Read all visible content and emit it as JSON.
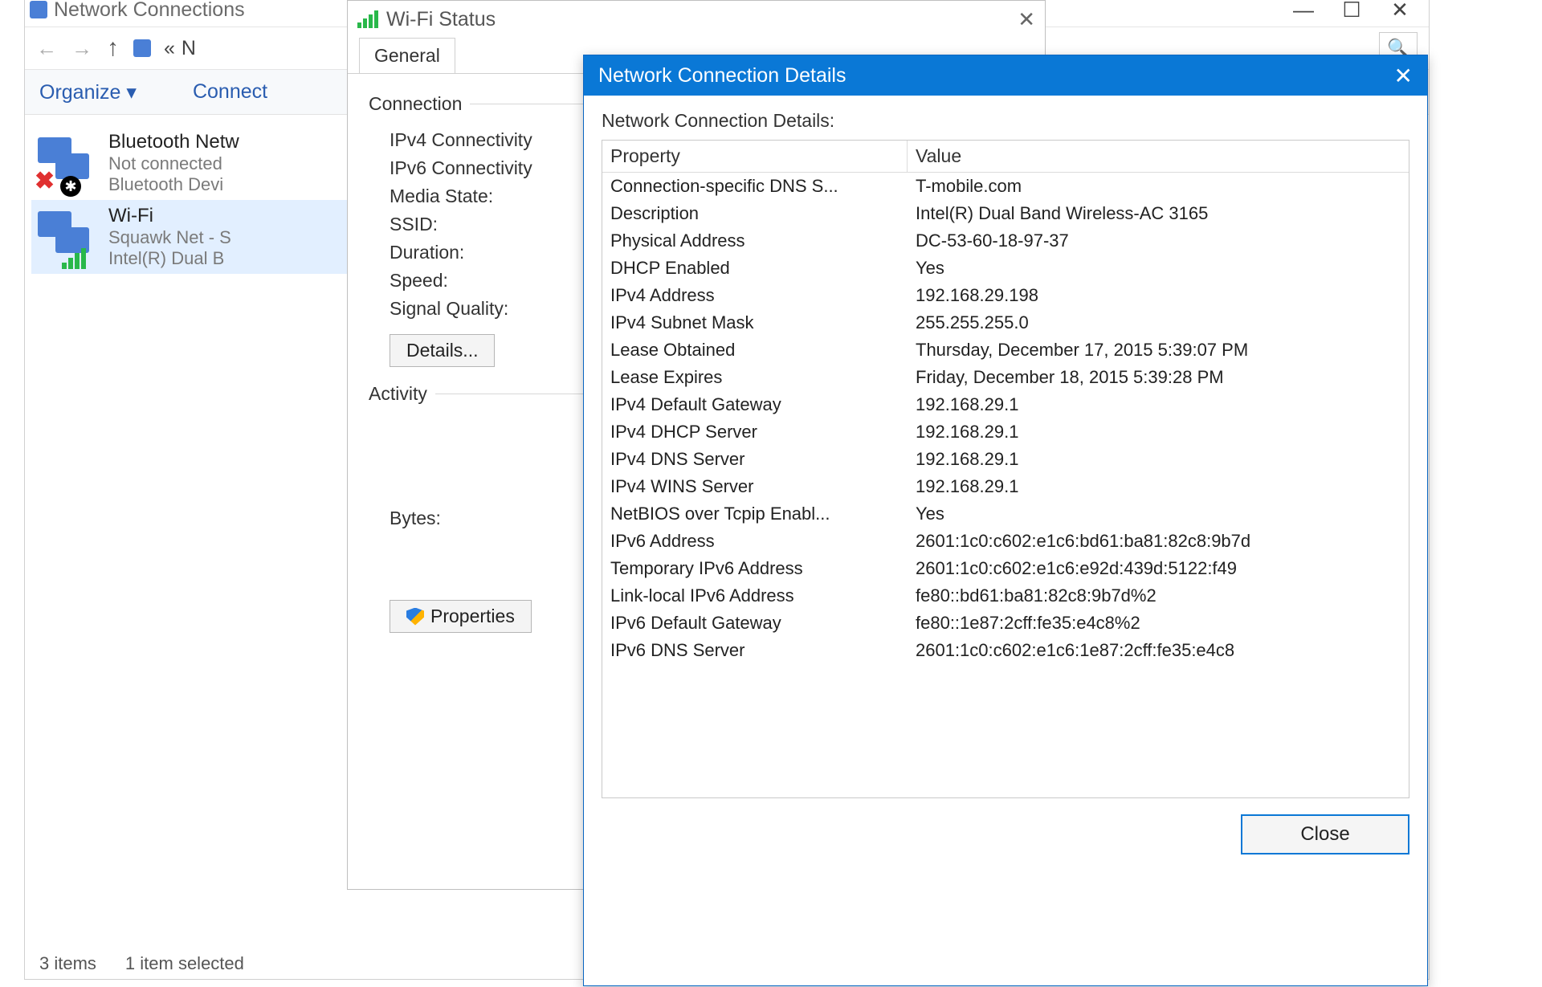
{
  "nc": {
    "title": "Network Connections",
    "breadcrumb_prefix": "«",
    "breadcrumb_letter": "N",
    "organize": "Organize",
    "connect": "Connect",
    "items": [
      {
        "name": "Bluetooth Netw",
        "status": "Not connected",
        "adapter": "Bluetooth Devi",
        "kind": "bt"
      },
      {
        "name": "Wi-Fi",
        "status": "Squawk Net - S",
        "adapter": "Intel(R) Dual B",
        "kind": "wifi"
      }
    ],
    "status_left": "3 items",
    "status_right": "1 item selected"
  },
  "ws": {
    "title": "Wi-Fi Status",
    "tab": "General",
    "group_connection": "Connection",
    "rows": {
      "ipv4": "IPv4 Connectivity",
      "ipv6": "IPv6 Connectivity",
      "media": "Media State:",
      "ssid": "SSID:",
      "duration": "Duration:",
      "speed": "Speed:",
      "signal": "Signal Quality:"
    },
    "details_btn": "Details...",
    "group_activity": "Activity",
    "bytes": "Bytes:",
    "properties_btn": "Properties"
  },
  "cd": {
    "title": "Network Connection Details",
    "caption": "Network Connection Details:",
    "header_property": "Property",
    "header_value": "Value",
    "rows": [
      {
        "p": "Connection-specific DNS S...",
        "v": "T-mobile.com"
      },
      {
        "p": "Description",
        "v": "Intel(R) Dual Band Wireless-AC 3165"
      },
      {
        "p": "Physical Address",
        "v": "DC-53-60-18-97-37"
      },
      {
        "p": "DHCP Enabled",
        "v": "Yes"
      },
      {
        "p": "IPv4 Address",
        "v": "192.168.29.198"
      },
      {
        "p": "IPv4 Subnet Mask",
        "v": "255.255.255.0"
      },
      {
        "p": "Lease Obtained",
        "v": "Thursday, December 17, 2015 5:39:07 PM"
      },
      {
        "p": "Lease Expires",
        "v": "Friday, December 18, 2015 5:39:28 PM"
      },
      {
        "p": "IPv4 Default Gateway",
        "v": "192.168.29.1"
      },
      {
        "p": "IPv4 DHCP Server",
        "v": "192.168.29.1"
      },
      {
        "p": "IPv4 DNS Server",
        "v": "192.168.29.1"
      },
      {
        "p": "IPv4 WINS Server",
        "v": "192.168.29.1"
      },
      {
        "p": "NetBIOS over Tcpip Enabl...",
        "v": "Yes"
      },
      {
        "p": "IPv6 Address",
        "v": "2601:1c0:c602:e1c6:bd61:ba81:82c8:9b7d"
      },
      {
        "p": "Temporary IPv6 Address",
        "v": "2601:1c0:c602:e1c6:e92d:439d:5122:f49"
      },
      {
        "p": "Link-local IPv6 Address",
        "v": "fe80::bd61:ba81:82c8:9b7d%2"
      },
      {
        "p": "IPv6 Default Gateway",
        "v": "fe80::1e87:2cff:fe35:e4c8%2"
      },
      {
        "p": "IPv6 DNS Server",
        "v": "2601:1c0:c602:e1c6:1e87:2cff:fe35:e4c8"
      }
    ],
    "close_btn": "Close"
  }
}
